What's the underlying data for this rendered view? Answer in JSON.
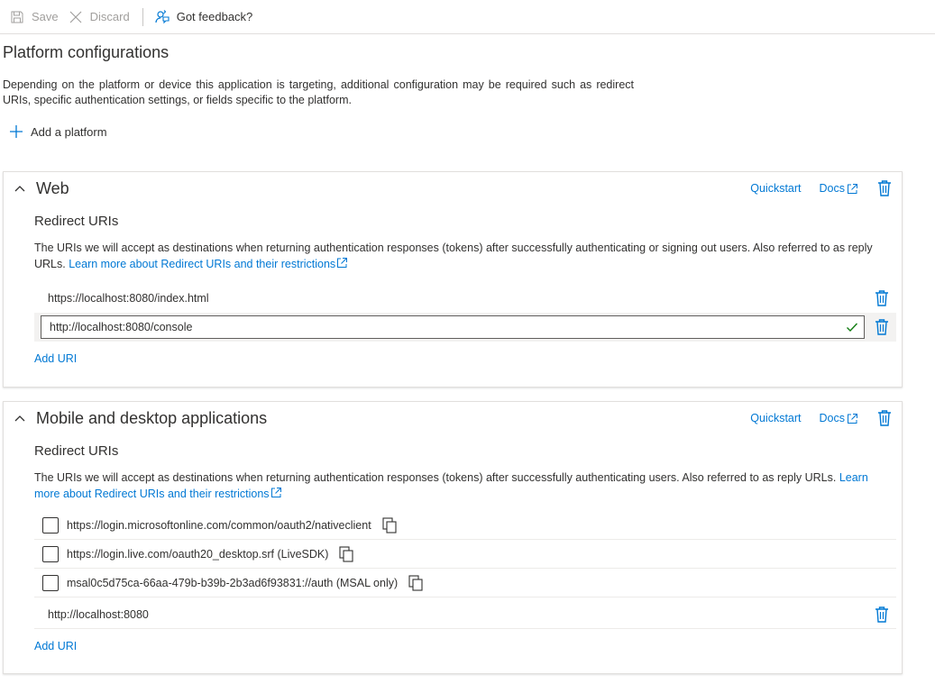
{
  "toolbar": {
    "save_label": "Save",
    "discard_label": "Discard",
    "feedback_label": "Got feedback?"
  },
  "page": {
    "title": "Platform configurations",
    "description": "Depending on the platform or device this application is targeting, additional configuration may be required such as redirect URIs, specific authentication settings, or fields specific to the platform.",
    "add_platform_label": "Add a platform"
  },
  "web": {
    "title": "Web",
    "quickstart_label": "Quickstart",
    "docs_label": "Docs",
    "redirect_title": "Redirect URIs",
    "redirect_desc": "The URIs we will accept as destinations when returning authentication responses (tokens) after successfully authenticating or signing out users. Also referred to as reply URLs.",
    "learn_more_label": "Learn more about Redirect URIs and their restrictions",
    "uris": [
      "https://localhost:8080/index.html"
    ],
    "editing_uri_value": "http://localhost:8080/console",
    "add_uri_label": "Add URI"
  },
  "mobile": {
    "title": "Mobile and desktop applications",
    "quickstart_label": "Quickstart",
    "docs_label": "Docs",
    "redirect_title": "Redirect URIs",
    "redirect_desc": "The URIs we will accept as destinations when returning authentication responses (tokens) after successfully authenticating users. Also referred to as reply URLs.",
    "learn_more_label": "Learn more about Redirect URIs and their restrictions",
    "suggested_uris": [
      {
        "label": "https://login.microsoftonline.com/common/oauth2/nativeclient",
        "checked": false
      },
      {
        "label": "https://login.live.com/oauth20_desktop.srf (LiveSDK)",
        "checked": false
      },
      {
        "label": "msal0c5d75ca-66aa-479b-b39b-2b3ad6f93831://auth (MSAL only)",
        "checked": false
      }
    ],
    "custom_uris": [
      "http://localhost:8080"
    ],
    "add_uri_label": "Add URI"
  },
  "colors": {
    "accent": "#0078d4",
    "success": "#107c10",
    "text": "#323130",
    "disabled": "#a19f9d"
  },
  "icons": {
    "save": "save-icon",
    "discard": "close-icon",
    "feedback": "feedback-icon",
    "add": "plus-icon",
    "collapse": "chevron-up-icon",
    "external": "external-link-icon",
    "delete": "trash-icon",
    "copy": "copy-icon",
    "valid": "checkmark-icon"
  }
}
